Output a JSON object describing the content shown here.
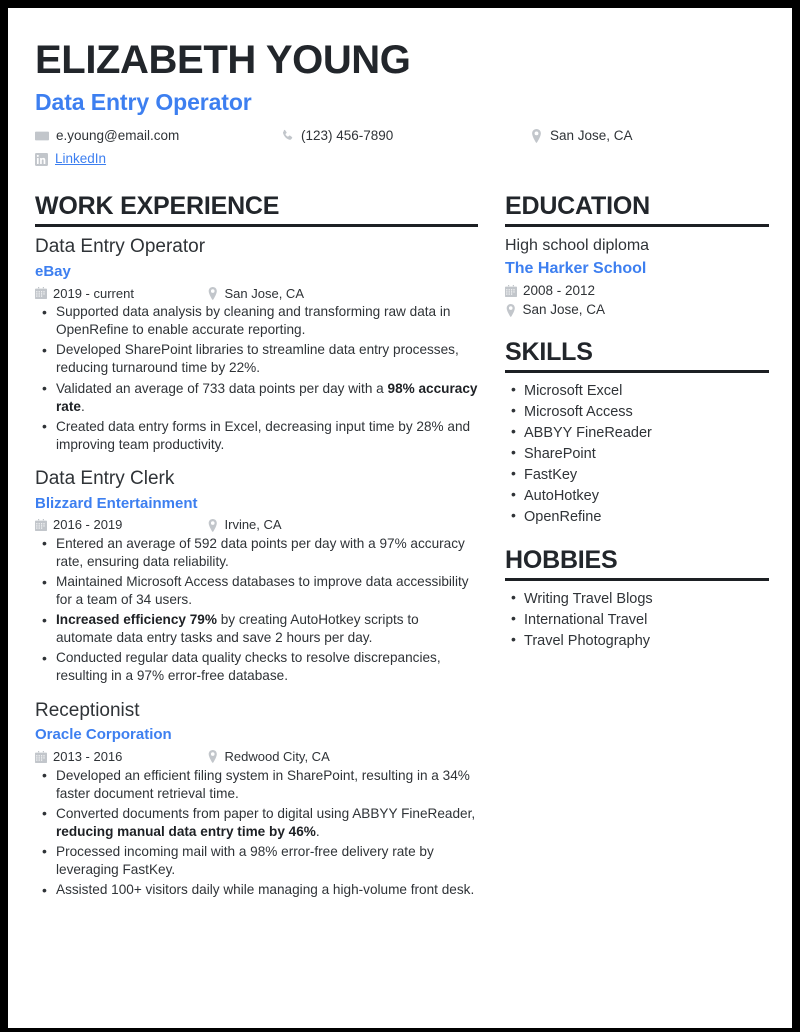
{
  "document": {
    "type": "resume",
    "accent_color": "#3d7ff0",
    "text_color": "#2f3337",
    "heading_color": "#22262b",
    "icon_color": "#c2c6cb",
    "page_background": "#ffffff",
    "frame_color": "#000000"
  },
  "header": {
    "name": "Elizabeth Young",
    "role": "Data Entry Operator",
    "contacts": {
      "email": "e.young@email.com",
      "phone": "(123) 456-7890",
      "location": "San Jose, CA",
      "linkedin": "LinkedIn"
    },
    "icons": {
      "email": "envelope-icon",
      "phone": "phone-icon",
      "location": "map-pin-icon",
      "linkedin": "linkedin-icon"
    }
  },
  "sections": {
    "work_experience": {
      "title": "Work Experience",
      "entries": [
        {
          "title": "Data Entry Operator",
          "org": "eBay",
          "dates": "2019 - current",
          "location": "San Jose, CA",
          "bullets": [
            {
              "parts": [
                {
                  "text": "Supported data analysis by cleaning and transforming raw data in OpenRefine to enable accurate reporting.",
                  "bold": false
                }
              ]
            },
            {
              "parts": [
                {
                  "text": "Developed SharePoint libraries to streamline data entry processes, reducing turnaround time by 22%.",
                  "bold": false
                }
              ]
            },
            {
              "parts": [
                {
                  "text": "Validated an average of 733 data points per day with a ",
                  "bold": false
                },
                {
                  "text": "98% accuracy rate",
                  "bold": true
                },
                {
                  "text": ".",
                  "bold": false
                }
              ]
            },
            {
              "parts": [
                {
                  "text": "Created data entry forms in Excel, decreasing input time by 28% and improving team productivity.",
                  "bold": false
                }
              ]
            }
          ]
        },
        {
          "title": "Data Entry Clerk",
          "org": "Blizzard Entertainment",
          "dates": "2016 - 2019",
          "location": "Irvine, CA",
          "bullets": [
            {
              "parts": [
                {
                  "text": "Entered an average of 592 data points per day with a 97% accuracy rate, ensuring data reliability.",
                  "bold": false
                }
              ]
            },
            {
              "parts": [
                {
                  "text": "Maintained Microsoft Access databases to improve data accessibility for a team of 34 users.",
                  "bold": false
                }
              ]
            },
            {
              "parts": [
                {
                  "text": "Increased efficiency 79%",
                  "bold": true
                },
                {
                  "text": " by creating AutoHotkey scripts to automate data entry tasks and save 2 hours per day.",
                  "bold": false
                }
              ]
            },
            {
              "parts": [
                {
                  "text": "Conducted regular data quality checks to resolve discrepancies, resulting in a 97% error-free database.",
                  "bold": false
                }
              ]
            }
          ]
        },
        {
          "title": "Receptionist",
          "org": "Oracle Corporation",
          "dates": "2013 - 2016",
          "location": "Redwood City, CA",
          "bullets": [
            {
              "parts": [
                {
                  "text": "Developed an efficient filing system in SharePoint, resulting in a 34% faster document retrieval time.",
                  "bold": false
                }
              ]
            },
            {
              "parts": [
                {
                  "text": "Converted documents from paper to digital using ABBYY FineReader, ",
                  "bold": false
                },
                {
                  "text": "reducing manual data entry time by 46%",
                  "bold": true
                },
                {
                  "text": ".",
                  "bold": false
                }
              ]
            },
            {
              "parts": [
                {
                  "text": "Processed incoming mail with a 98% error-free delivery rate by leveraging FastKey.",
                  "bold": false
                }
              ]
            },
            {
              "parts": [
                {
                  "text": "Assisted 100+ visitors daily while managing a high-volume front desk.",
                  "bold": false
                }
              ]
            }
          ]
        }
      ]
    },
    "education": {
      "title": "Education",
      "entries": [
        {
          "degree": "High school diploma",
          "school": "The Harker School",
          "dates": "2008 - 2012",
          "location": "San Jose, CA"
        }
      ]
    },
    "skills": {
      "title": "Skills",
      "items": [
        "Microsoft Excel",
        "Microsoft Access",
        "ABBYY FineReader",
        "SharePoint",
        "FastKey",
        "AutoHotkey",
        "OpenRefine"
      ]
    },
    "hobbies": {
      "title": "Hobbies",
      "items": [
        "Writing Travel Blogs",
        "International Travel",
        "Travel Photography"
      ]
    }
  }
}
